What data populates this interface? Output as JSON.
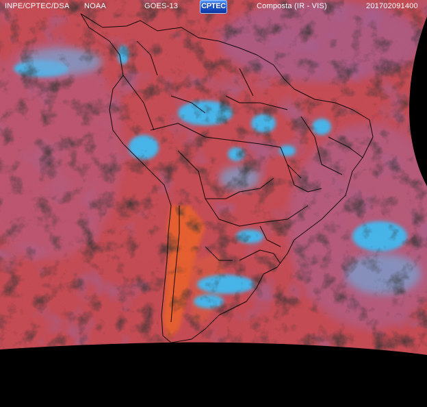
{
  "header": {
    "agency": "INPE/CPTEC/DSA",
    "partner": "NOAA",
    "satellite": "GOES-13",
    "logo_text": "CPTEC",
    "product": "Composta (IR - VIS)",
    "timestamp": "201702091400"
  },
  "colors": {
    "background": "#000000",
    "clear_warm": "#c8444c",
    "land_hot": "#e05a2a",
    "cold_cloud": "#3fb0e8",
    "high_cloud": "#7a7fd0",
    "low_cloud": "#303030",
    "haze": "#b07aa0",
    "borders": "#000000",
    "header_text": "#ffffff"
  },
  "icons": [
    "cptec-logo-icon"
  ]
}
